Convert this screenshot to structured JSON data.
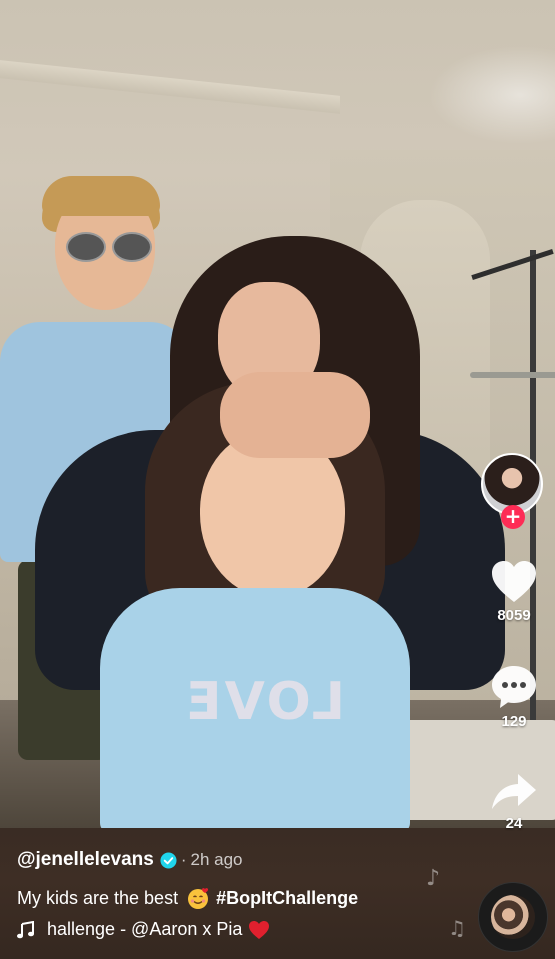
{
  "post": {
    "username": "@jenellelevans",
    "time_separator": "·",
    "time_ago": "2h ago",
    "description": "My kids are the best",
    "hashtag": "#BopItChallenge",
    "music_text": "hallenge - @Aaron x Pia"
  },
  "actions": {
    "likes": "8059",
    "comments": "129",
    "shares": "24",
    "follow_symbol": "+"
  },
  "icons": {
    "verified": "verified-check-icon",
    "music": "music-note-icon",
    "like": "heart-icon",
    "comment": "comment-bubble-icon",
    "share": "share-arrow-icon"
  },
  "colors": {
    "follow_accent": "#fe2c55",
    "verified_blue": "#20d5ec",
    "heart_red": "#e0202e"
  },
  "video": {
    "shirt_print": "LOVE"
  }
}
